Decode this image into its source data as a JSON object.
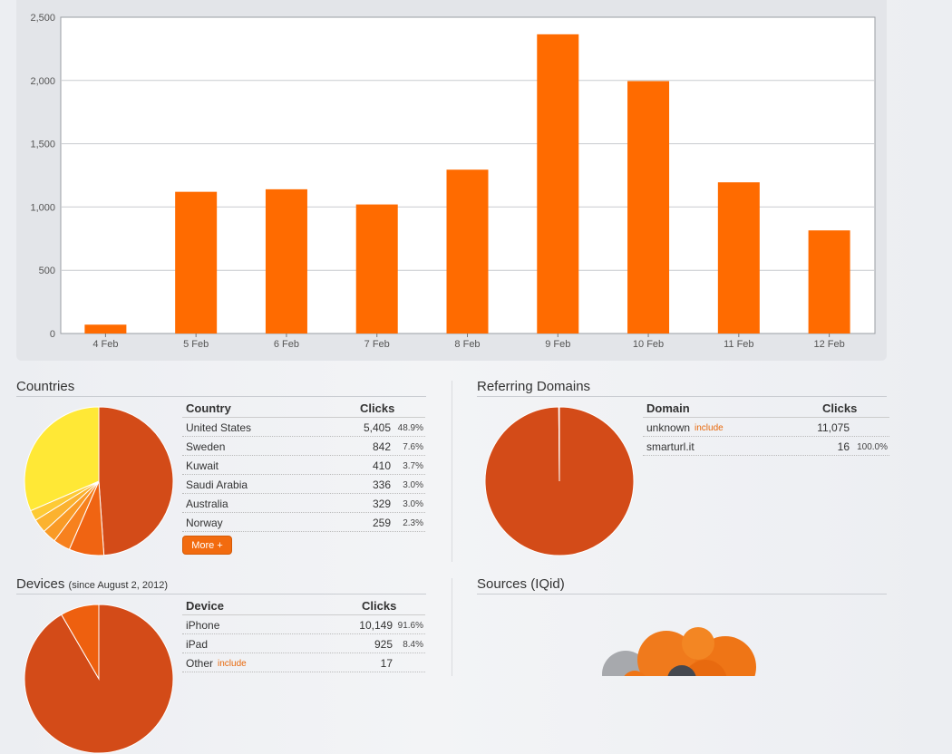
{
  "colors": {
    "bar": "#ff6b00",
    "accent": "#f26b0f",
    "pie_main": "#d34b18",
    "pie_yellow": "#ffe836"
  },
  "chart_data": {
    "type": "bar",
    "categories": [
      "4 Feb",
      "5 Feb",
      "6 Feb",
      "7 Feb",
      "8 Feb",
      "9 Feb",
      "10 Feb",
      "11 Feb",
      "12 Feb"
    ],
    "values": [
      70,
      1120,
      1140,
      1020,
      1295,
      2365,
      1995,
      1195,
      815
    ],
    "ylim": [
      0,
      2500
    ],
    "yticks": [
      "0",
      "500",
      "1,000",
      "1,500",
      "2,000",
      "2,500"
    ],
    "grid": true
  },
  "countries": {
    "title": "Countries",
    "header": {
      "name": "Country",
      "clicks": "Clicks"
    },
    "rows": [
      {
        "name": "United States",
        "clicks": "5,405",
        "pct": "48.9%"
      },
      {
        "name": "Sweden",
        "clicks": "842",
        "pct": "7.6%"
      },
      {
        "name": "Kuwait",
        "clicks": "410",
        "pct": "3.7%"
      },
      {
        "name": "Saudi Arabia",
        "clicks": "336",
        "pct": "3.0%"
      },
      {
        "name": "Australia",
        "clicks": "329",
        "pct": "3.0%"
      },
      {
        "name": "Norway",
        "clicks": "259",
        "pct": "2.3%"
      }
    ],
    "more_label": "More +",
    "pie": [
      48.9,
      7.6,
      3.7,
      3.0,
      3.0,
      2.3,
      31.5
    ]
  },
  "referring": {
    "title": "Referring Domains",
    "header": {
      "name": "Domain",
      "clicks": "Clicks"
    },
    "rows": [
      {
        "name": "unknown",
        "tag": "include",
        "clicks": "11,075",
        "pct": ""
      },
      {
        "name": "smarturl.it",
        "tag": "",
        "clicks": "16",
        "pct": "100.0%"
      }
    ]
  },
  "devices": {
    "title": "Devices",
    "subtitle": "(since August 2, 2012)",
    "header": {
      "name": "Device",
      "clicks": "Clicks"
    },
    "rows": [
      {
        "name": "iPhone",
        "tag": "",
        "clicks": "10,149",
        "pct": "91.6%"
      },
      {
        "name": "iPad",
        "tag": "",
        "clicks": "925",
        "pct": "8.4%"
      },
      {
        "name": "Other",
        "tag": "include",
        "clicks": "17",
        "pct": ""
      }
    ]
  },
  "sources": {
    "title": "Sources (IQid)"
  }
}
